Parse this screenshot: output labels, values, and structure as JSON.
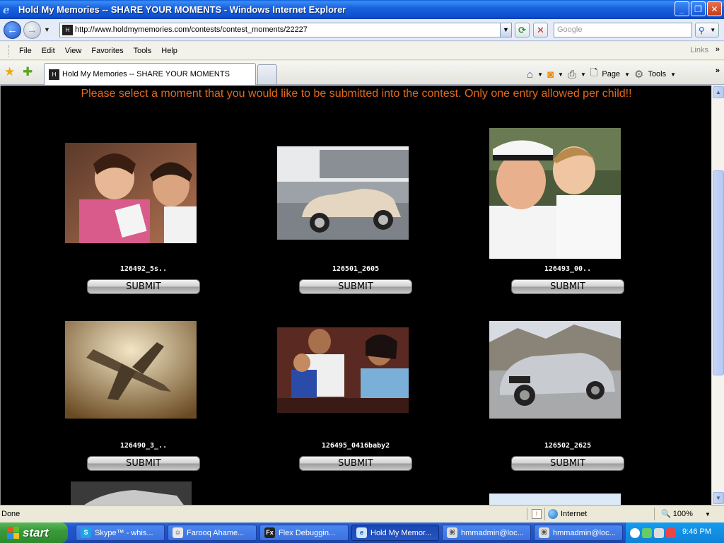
{
  "window": {
    "title": "Hold My Memories -- SHARE YOUR MOMENTS - Windows Internet Explorer",
    "controls": {
      "minimize": "_",
      "maximize": "❐",
      "close": "✕"
    }
  },
  "address": {
    "url": "http://www.holdmymemories.com/contests/contest_moments/22227",
    "search_placeholder": "Google"
  },
  "menu": [
    "File",
    "Edit",
    "View",
    "Favorites",
    "Tools",
    "Help"
  ],
  "links_label": "Links",
  "tab": {
    "title": "Hold My Memories -- SHARE YOUR MOMENTS"
  },
  "command_bar": {
    "page": "Page",
    "tools": "Tools"
  },
  "page": {
    "headline": "Please select a moment that you would like to be submitted into the contest. Only one entry allowed per child!!",
    "submit_label": "SUBMIT",
    "moments": [
      {
        "caption": "126492_5s..",
        "subject": "couple-eating-noodles"
      },
      {
        "caption": "126501_2605",
        "subject": "vintage-car"
      },
      {
        "caption": "126493_00..",
        "subject": "officer-with-boy"
      },
      {
        "caption": "126490_3_..",
        "subject": "fighter-jet"
      },
      {
        "caption": "126495_0416baby2",
        "subject": "family-with-baby"
      },
      {
        "caption": "126502_2625",
        "subject": "silver-sedan"
      }
    ]
  },
  "status": {
    "text": "Done",
    "zone": "Internet",
    "zoom": "100%"
  },
  "taskbar": {
    "start": "start",
    "buttons": [
      {
        "label": "Skype™ - whis..."
      },
      {
        "label": "Farooq Ahame..."
      },
      {
        "label": "Flex Debuggin..."
      },
      {
        "label": "Hold My Memor..."
      },
      {
        "label": "hmmadmin@loc..."
      },
      {
        "label": "hmmadmin@loc..."
      }
    ],
    "clock": "9:46 PM"
  }
}
